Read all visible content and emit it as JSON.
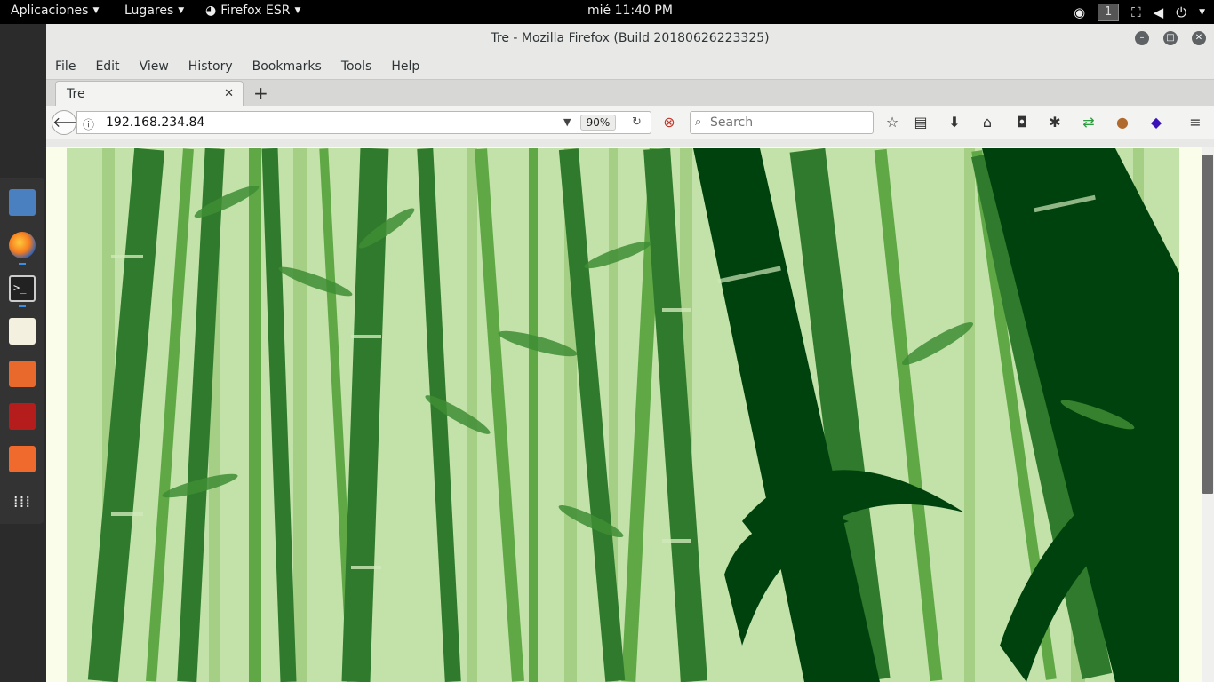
{
  "topbar": {
    "applications": "Aplicaciones",
    "places": "Lugares",
    "app_menu": "Firefox ESR",
    "clock": "mié 11:40 PM",
    "workspace": "1"
  },
  "window": {
    "title": "Tre - Mozilla Firefox (Build 20180626223325)"
  },
  "menubar": [
    "File",
    "Edit",
    "View",
    "History",
    "Bookmarks",
    "Tools",
    "Help"
  ],
  "tab": {
    "label": "Tre"
  },
  "navbar": {
    "url": "192.168.234.84",
    "zoom": "90%",
    "search_placeholder": "Search"
  },
  "dock": {
    "apps": [
      "file-manager",
      "firefox",
      "terminal",
      "text-editor",
      "burpsuite",
      "metasploit",
      "zaproxy",
      "show-applications"
    ]
  },
  "colors": {
    "bamboo_light": "#c3e2a9",
    "bamboo_mid": "#4f9a3a",
    "bamboo_dark": "#00420d"
  }
}
